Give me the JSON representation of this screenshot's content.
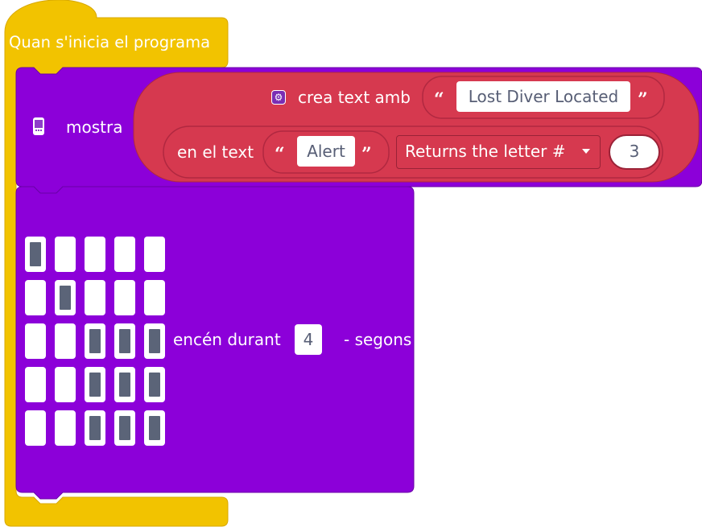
{
  "colors": {
    "hat": "#f2c300",
    "hat_border": "#d8a800",
    "basic": "#8c00d9",
    "basic_border": "#6a00a8",
    "text_block": "#d6394f",
    "text_block_border": "#b02840"
  },
  "hat_block": {
    "label": "Quan s'inicia el programa"
  },
  "show_block": {
    "label": "mostra",
    "icon": "microbit-icon"
  },
  "create_text": {
    "icon": "gear-icon",
    "label": "crea text amb",
    "open_quote": "“",
    "close_quote": "”",
    "string_value": "Lost Diver Located"
  },
  "letter_block": {
    "label": "en el text",
    "open_quote": "“",
    "close_quote": "”",
    "string_value": "Alert",
    "dropdown": "Returns the letter #",
    "index_value": "3"
  },
  "leds_block": {
    "grid": [
      [
        1,
        0,
        0,
        0,
        0
      ],
      [
        0,
        1,
        0,
        0,
        0
      ],
      [
        0,
        0,
        1,
        1,
        1
      ],
      [
        0,
        0,
        1,
        1,
        1
      ],
      [
        0,
        0,
        1,
        1,
        1
      ]
    ],
    "label_on": "encén durant",
    "duration_value": "4",
    "label_units": "- segons"
  }
}
